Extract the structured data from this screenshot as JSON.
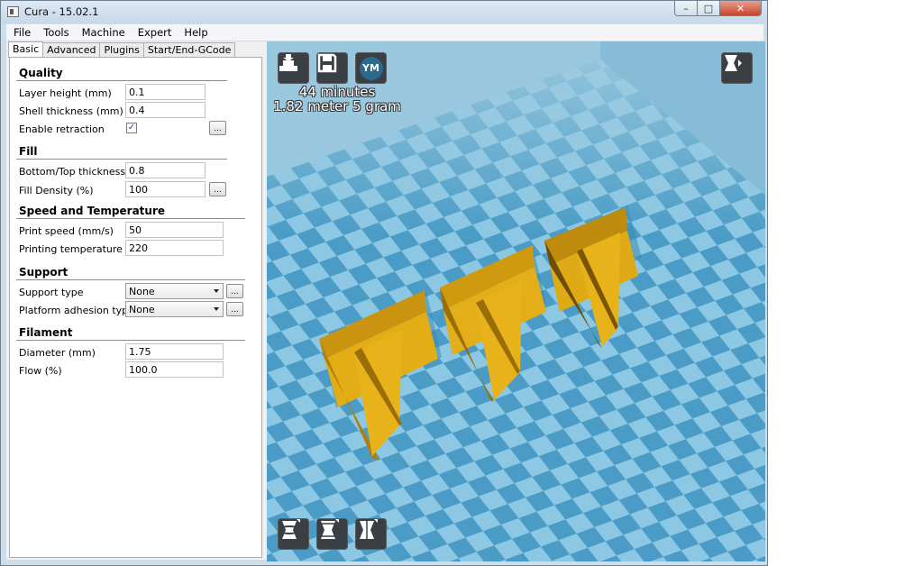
{
  "window": {
    "title": "Cura - 15.02.1"
  },
  "menu": [
    "File",
    "Tools",
    "Machine",
    "Expert",
    "Help"
  ],
  "tabs": [
    "Basic",
    "Advanced",
    "Plugins",
    "Start/End-GCode"
  ],
  "sections": {
    "quality": "Quality",
    "fill": "Fill",
    "speed": "Speed and Temperature",
    "support": "Support",
    "filament": "Filament"
  },
  "fields": {
    "layer_height": {
      "label": "Layer height (mm)",
      "value": "0.1"
    },
    "shell_thickness": {
      "label": "Shell thickness (mm)",
      "value": "0.4"
    },
    "enable_retraction": {
      "label": "Enable retraction",
      "checked": true
    },
    "bottom_top_thickness": {
      "label": "Bottom/Top thickness (mm)",
      "value": "0.8"
    },
    "fill_density": {
      "label": "Fill Density (%)",
      "value": "100"
    },
    "print_speed": {
      "label": "Print speed (mm/s)",
      "value": "50"
    },
    "printing_temperature": {
      "label": "Printing temperature (C)",
      "value": "220"
    },
    "support_type": {
      "label": "Support type",
      "value": "None"
    },
    "platform_adhesion": {
      "label": "Platform adhesion type",
      "value": "None"
    },
    "diameter": {
      "label": "Diameter (mm)",
      "value": "1.75"
    },
    "flow": {
      "label": "Flow (%)",
      "value": "100.0"
    }
  },
  "dots_label": "...",
  "print_info": {
    "time": "44 minutes",
    "material": "1.82 meter 5 gram"
  },
  "toolbar": {
    "account_badge": "YM"
  },
  "icons": {
    "load": "load-model-icon",
    "save": "save-toolpath-icon",
    "view_mode": "view-mode-icon",
    "rotate": "rotate-icon",
    "scale": "scale-icon",
    "mirror": "mirror-icon"
  },
  "colors": {
    "viewport_bg": "#6fb0d2",
    "model": "#e8b21a",
    "checker_dark": "#3f93be",
    "checker_light": "#8cc7e3"
  }
}
